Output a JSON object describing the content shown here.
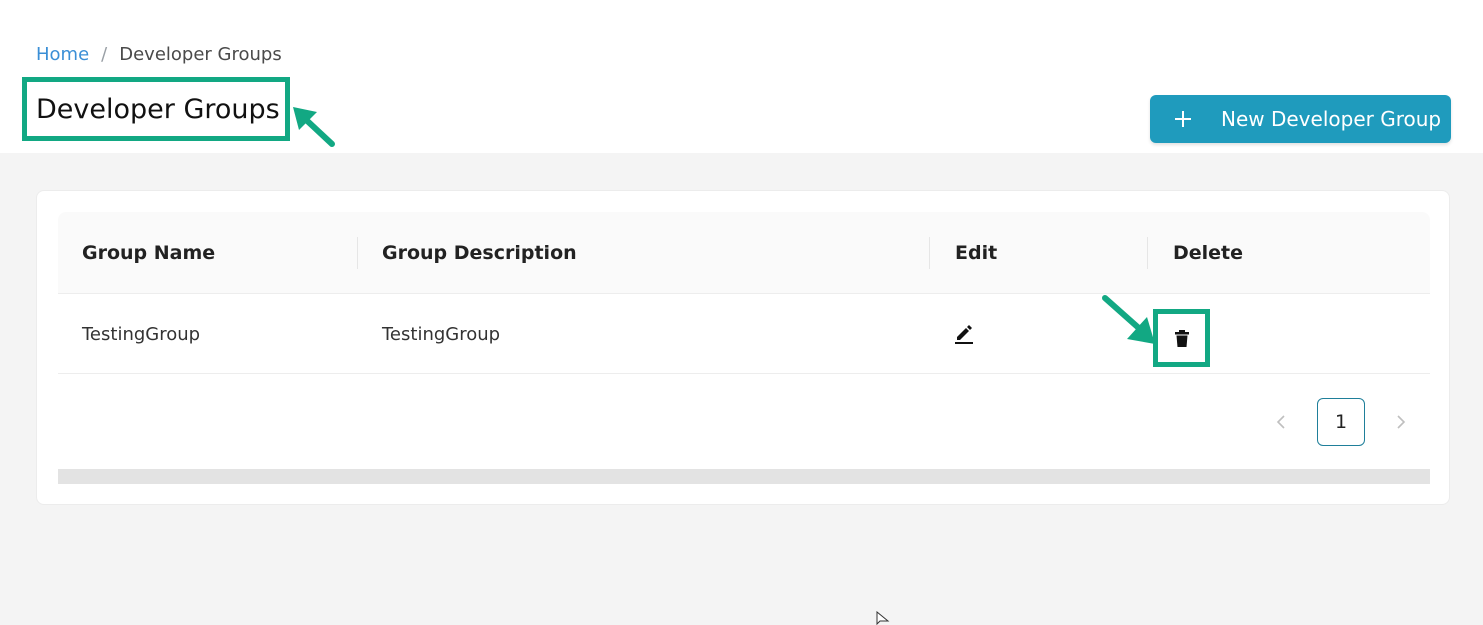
{
  "breadcrumb": {
    "home": "Home",
    "separator": "/",
    "current": "Developer Groups"
  },
  "page": {
    "title": "Developer Groups"
  },
  "actions": {
    "new_button_label": "New Developer Group",
    "new_button_icon": "plus-icon"
  },
  "table": {
    "columns": [
      "Group Name",
      "Group Description",
      "Edit",
      "Delete"
    ],
    "rows": [
      {
        "group_name": "TestingGroup",
        "group_description": "TestingGroup",
        "edit_icon": "pencil-icon",
        "delete_icon": "trash-icon"
      }
    ]
  },
  "pagination": {
    "current_page": "1",
    "prev_icon": "chevron-left-icon",
    "next_icon": "chevron-right-icon"
  },
  "colors": {
    "accent": "#1f9bbd",
    "annotation": "#12a883",
    "link": "#3b8fd6"
  }
}
